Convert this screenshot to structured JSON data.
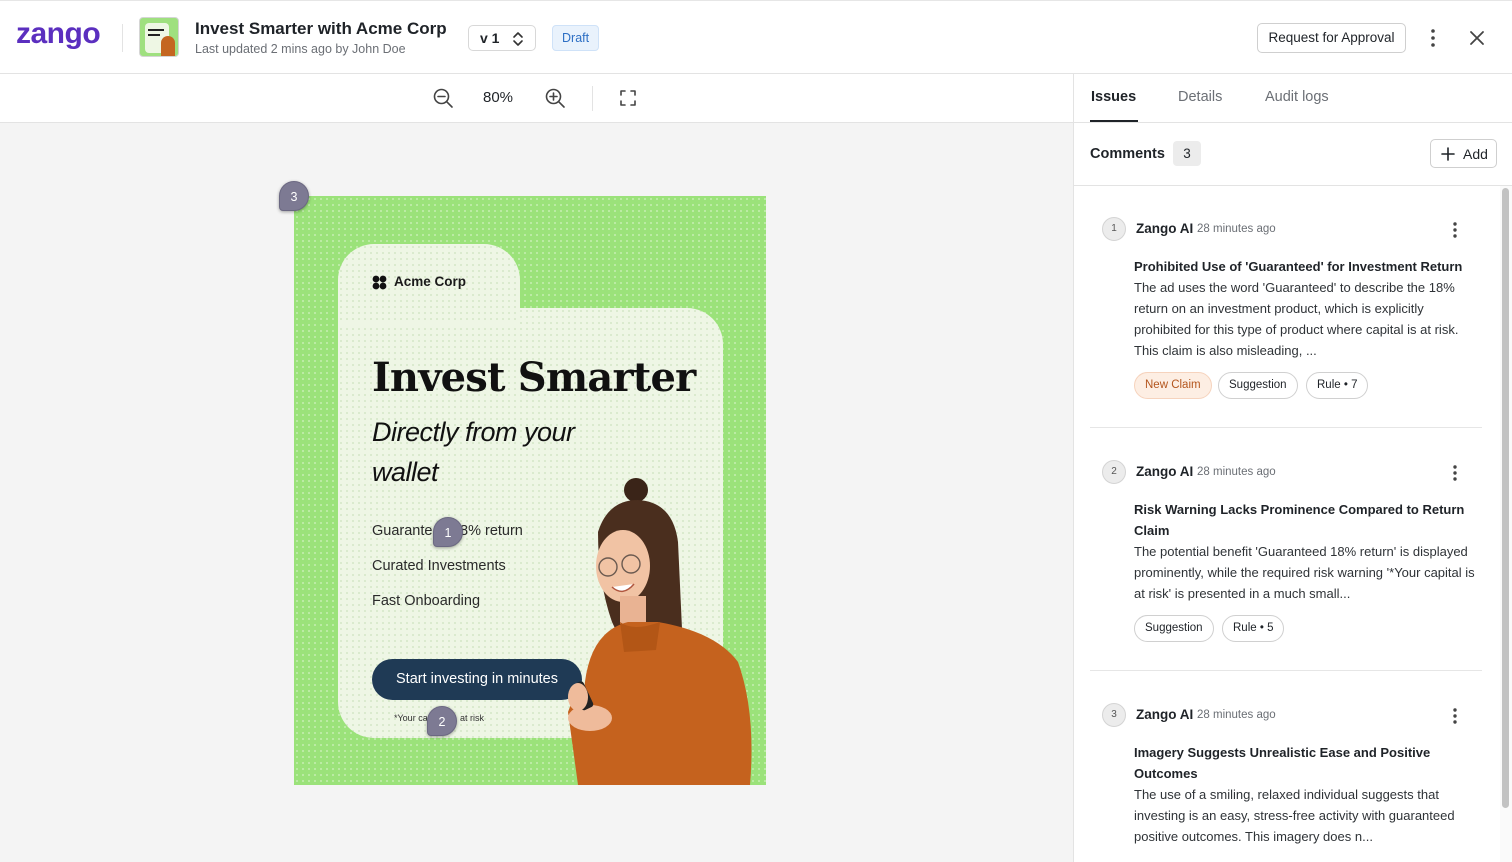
{
  "brand": {
    "logo": "zango"
  },
  "header": {
    "title": "Invest Smarter with Acme Corp",
    "subtitle": "Last updated 2 mins ago by John Doe",
    "version": "v 1",
    "status": "Draft",
    "approve_label": "Request for Approval",
    "icons": [
      "chevron-updown-icon",
      "kebab-icon",
      "close-icon"
    ]
  },
  "toolbar": {
    "zoom": "80%",
    "icons": [
      "zoom-out-icon",
      "zoom-in-icon",
      "fullscreen-icon"
    ]
  },
  "ad": {
    "brand": "Acme Corp",
    "headline": "Invest Smarter",
    "subheadline": "Directly from your wallet",
    "bullets": [
      "Guarante",
      "8% return",
      "Curated Investments",
      "Fast Onboarding"
    ],
    "cta": "Start investing in minutes",
    "risk_left": "*Your ca",
    "risk_right": "at risk",
    "pins": [
      "1",
      "2",
      "3"
    ]
  },
  "panel": {
    "tabs": [
      "Issues",
      "Details",
      "Audit logs"
    ],
    "active_tab": "Issues",
    "comments_label": "Comments",
    "comments_count": "3",
    "add_label": "Add",
    "comments": [
      {
        "num": "1",
        "author": "Zango AI",
        "time": "28 minutes ago",
        "title": "Prohibited Use of 'Guaranteed' for Investment Return",
        "body": "The ad uses the word 'Guaranteed' to describe the 18% return on an investment product, which is explicitly prohibited for this type of product where capital is at risk. This claim is also misleading, ...",
        "tags": [
          "New Claim",
          "Suggestion",
          "Rule • 7"
        ]
      },
      {
        "num": "2",
        "author": "Zango AI",
        "time": "28 minutes ago",
        "title": "Risk Warning Lacks Prominence Compared to Return Claim",
        "body": "The potential benefit 'Guaranteed 18% return' is displayed prominently, while the required risk warning '*Your capital is at risk' is presented in a much small...",
        "tags": [
          "Suggestion",
          "Rule • 5"
        ]
      },
      {
        "num": "3",
        "author": "Zango AI",
        "time": "28 minutes ago",
        "title": "Imagery Suggests Unrealistic Ease and Positive Outcomes",
        "body": "The use of a smiling, relaxed individual suggests that investing is an easy, stress-free activity with guaranteed positive outcomes. This imagery does n...",
        "tags": []
      }
    ]
  }
}
